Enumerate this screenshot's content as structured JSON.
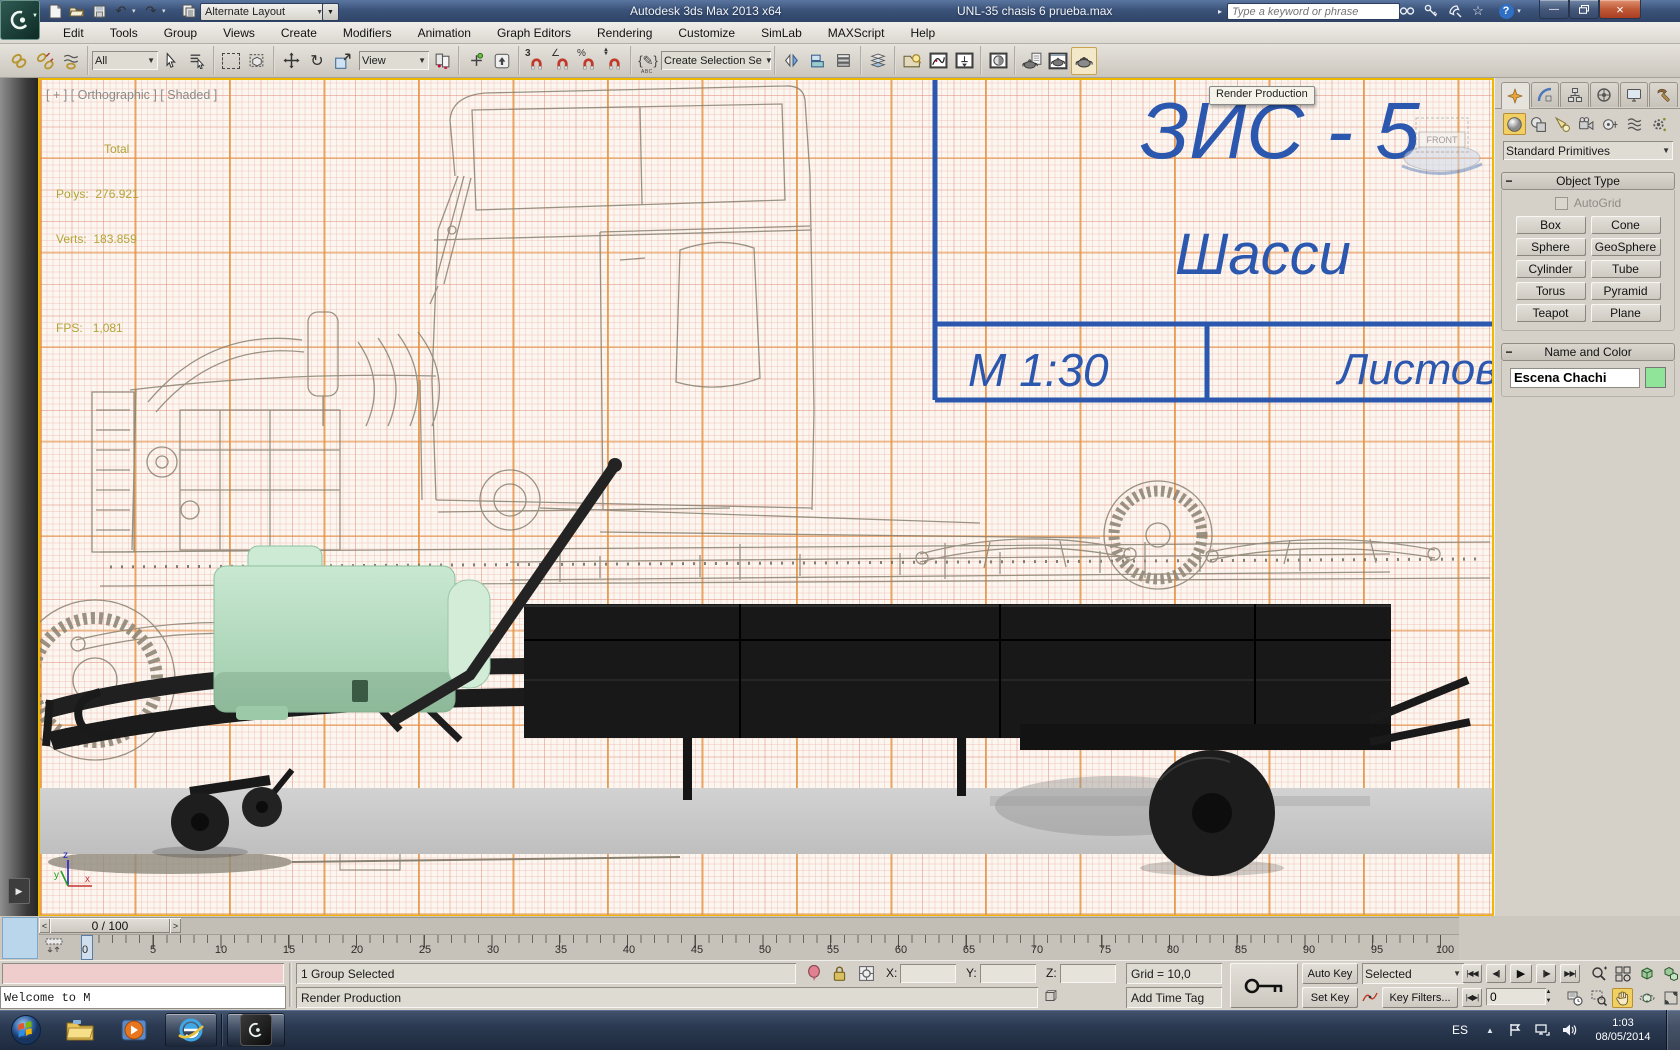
{
  "colors": {
    "viewport_border": "#ecb800",
    "blueprint_blue": "#2b57ae",
    "engine_green": "#b9e0c4",
    "stats_text": "#b3a437",
    "taskbar_blue": "#2b3a52"
  },
  "titlebar": {
    "app_title": "Autodesk 3ds Max  2013 x64",
    "doc_title": "UNL-35 chasis 6 prueba.max",
    "workspace": "Alternate Layout",
    "search_placeholder": "Type a keyword or phrase",
    "minimize": "—",
    "close": "×"
  },
  "menubar": {
    "items": [
      "Edit",
      "Tools",
      "Group",
      "Views",
      "Create",
      "Modifiers",
      "Animation",
      "Graph Editors",
      "Rendering",
      "Customize",
      "SimLab",
      "MAXScript",
      "Help"
    ]
  },
  "toolbar": {
    "filter_value": "All",
    "coord_value": "View",
    "selection_set_value": "Create Selection Se",
    "snap3_label": "3",
    "angle_label": "∠",
    "percent_label": "%",
    "abc_label": "ABC",
    "tooltip": "Render Production"
  },
  "viewport": {
    "label": "[ + ] [ Orthographic ] [ Shaded ]",
    "stats": {
      "total_label": "Total",
      "polys_label": "Polys:",
      "polys_value": "276.921",
      "verts_label": "Verts:",
      "verts_value": "183.859",
      "fps_label": "FPS:",
      "fps_value": "1,081"
    },
    "viewcube_label": "FRONT",
    "blueprint": {
      "title": "ЗИС - 5",
      "subtitle": "Шасси",
      "scale": "М 1:30",
      "sheets": "Листов"
    },
    "axis": {
      "x": "x",
      "y": "y",
      "z": "z"
    }
  },
  "command_panel": {
    "category_value": "Standard Primitives",
    "object_type": {
      "title": "Object Type",
      "autogrid": "AutoGrid",
      "buttons": [
        "Box",
        "Cone",
        "Sphere",
        "GeoSphere",
        "Cylinder",
        "Tube",
        "Torus",
        "Pyramid",
        "Teapot",
        "Plane"
      ]
    },
    "name_color": {
      "title": "Name and Color",
      "name": "Escena Chachi"
    }
  },
  "timeline": {
    "prev": "<",
    "next": ">",
    "slider_value": "0 / 100",
    "ruler_labels": [
      "0",
      "5",
      "10",
      "15",
      "20",
      "25",
      "30",
      "35",
      "40",
      "45",
      "50",
      "55",
      "60",
      "65",
      "70",
      "75",
      "80",
      "85",
      "90",
      "95",
      "100"
    ]
  },
  "status": {
    "listener_text": "Welcome to M",
    "prompt": "1 Group Selected",
    "status_line": "Render Production",
    "x_label": "X:",
    "y_label": "Y:",
    "z_label": "Z:",
    "grid_value": "Grid = 10,0",
    "add_time_tag": "Add Time Tag",
    "auto_key": "Auto Key",
    "set_key": "Set Key",
    "selected_value": "Selected",
    "key_filters": "Key Filters...",
    "frame_value": "0",
    "playback": {
      "start": "◀◀",
      "prev": "◀",
      "play": "▶",
      "next": "▶",
      "end": "▶▶",
      "keymode": "◀▶"
    }
  },
  "taskbar": {
    "tray_lang": "ES",
    "tray_caret": "▲",
    "time": "1:03",
    "date": "08/05/2014"
  }
}
